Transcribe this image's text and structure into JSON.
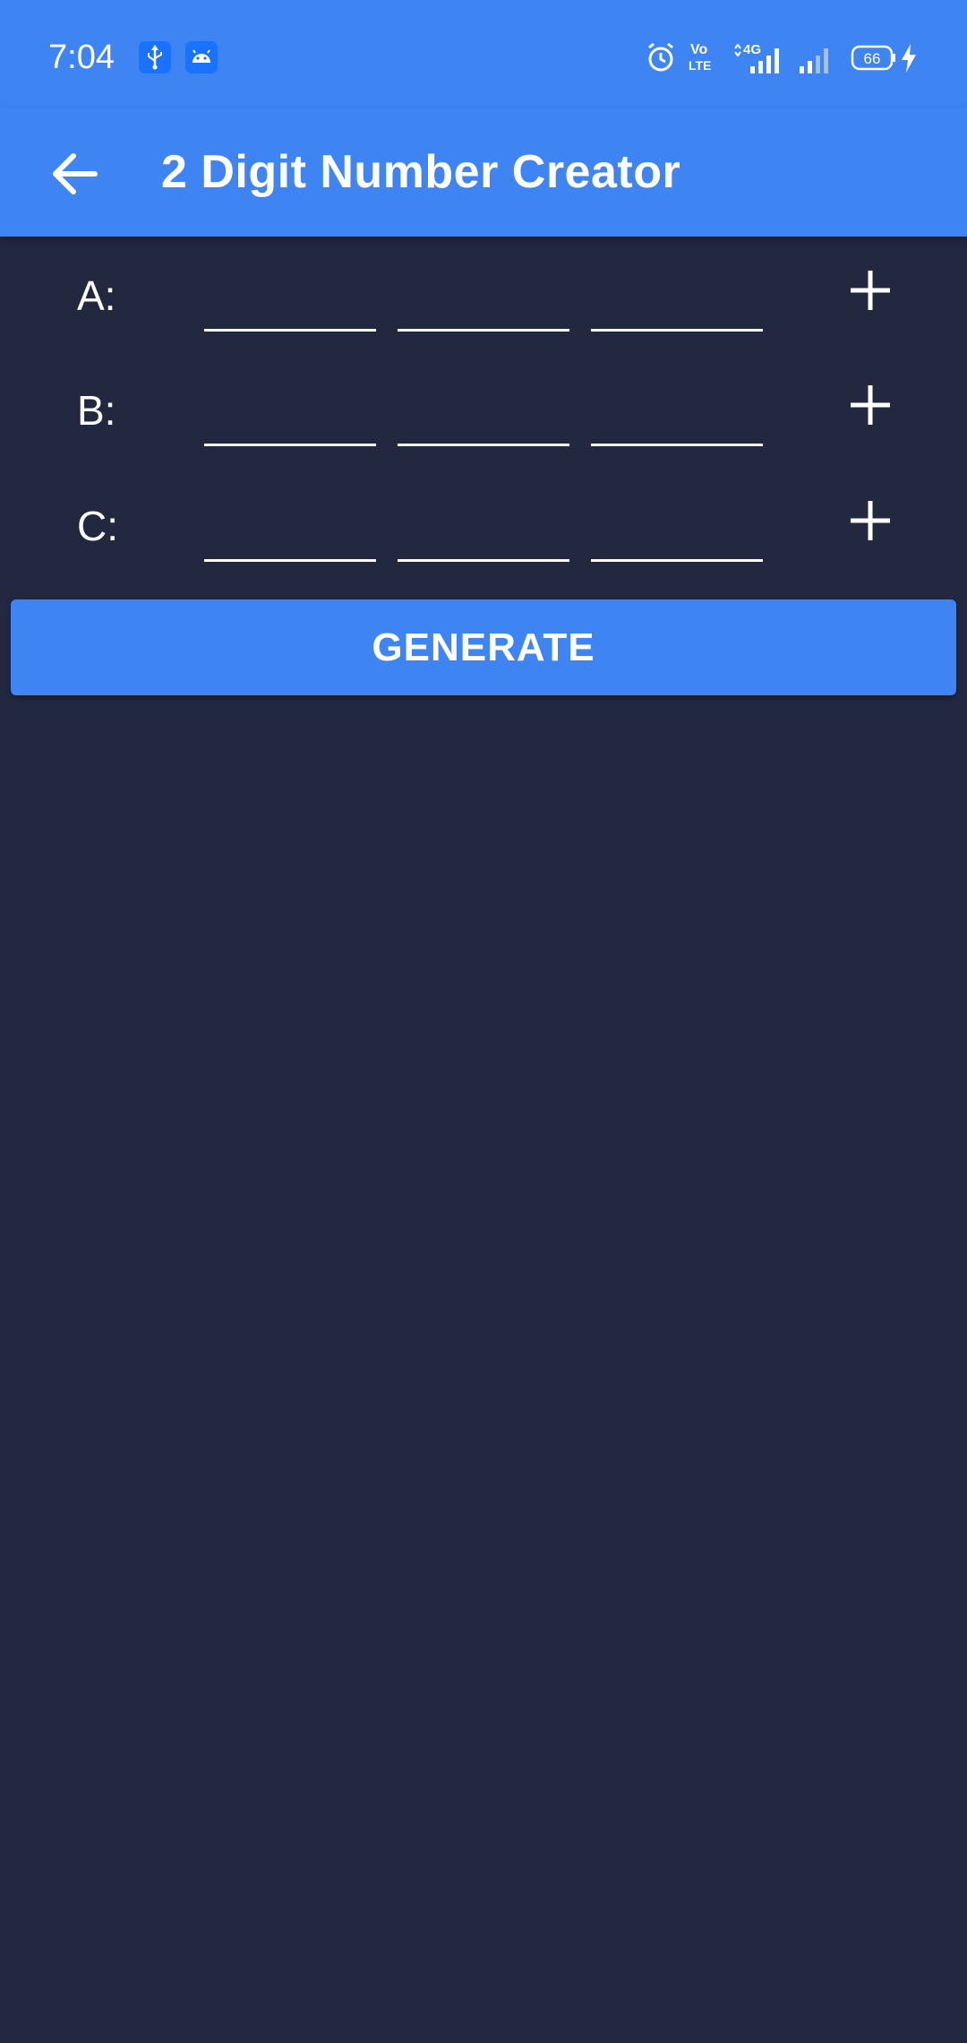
{
  "status_bar": {
    "time": "7:04",
    "network_label": "4G",
    "volte_label": "Vo\nLTE",
    "battery_level": "66",
    "icons": [
      "usb-icon",
      "android-icon",
      "alarm-icon",
      "volte-icon",
      "signal-4g-icon",
      "signal-icon",
      "battery-icon",
      "charging-icon"
    ]
  },
  "app_bar": {
    "title": "2 Digit Number Creator",
    "back_icon": "arrow-back-icon"
  },
  "rows": [
    {
      "label": "A:",
      "fields": [
        "",
        "",
        ""
      ],
      "add_icon": "plus-icon"
    },
    {
      "label": "B:",
      "fields": [
        "",
        "",
        ""
      ],
      "add_icon": "plus-icon"
    },
    {
      "label": "C:",
      "fields": [
        "",
        "",
        ""
      ],
      "add_icon": "plus-icon"
    }
  ],
  "generate_button": {
    "label": "GENERATE"
  },
  "colors": {
    "primary": "#3e84f3",
    "background": "#212840",
    "text": "#ffffff"
  }
}
